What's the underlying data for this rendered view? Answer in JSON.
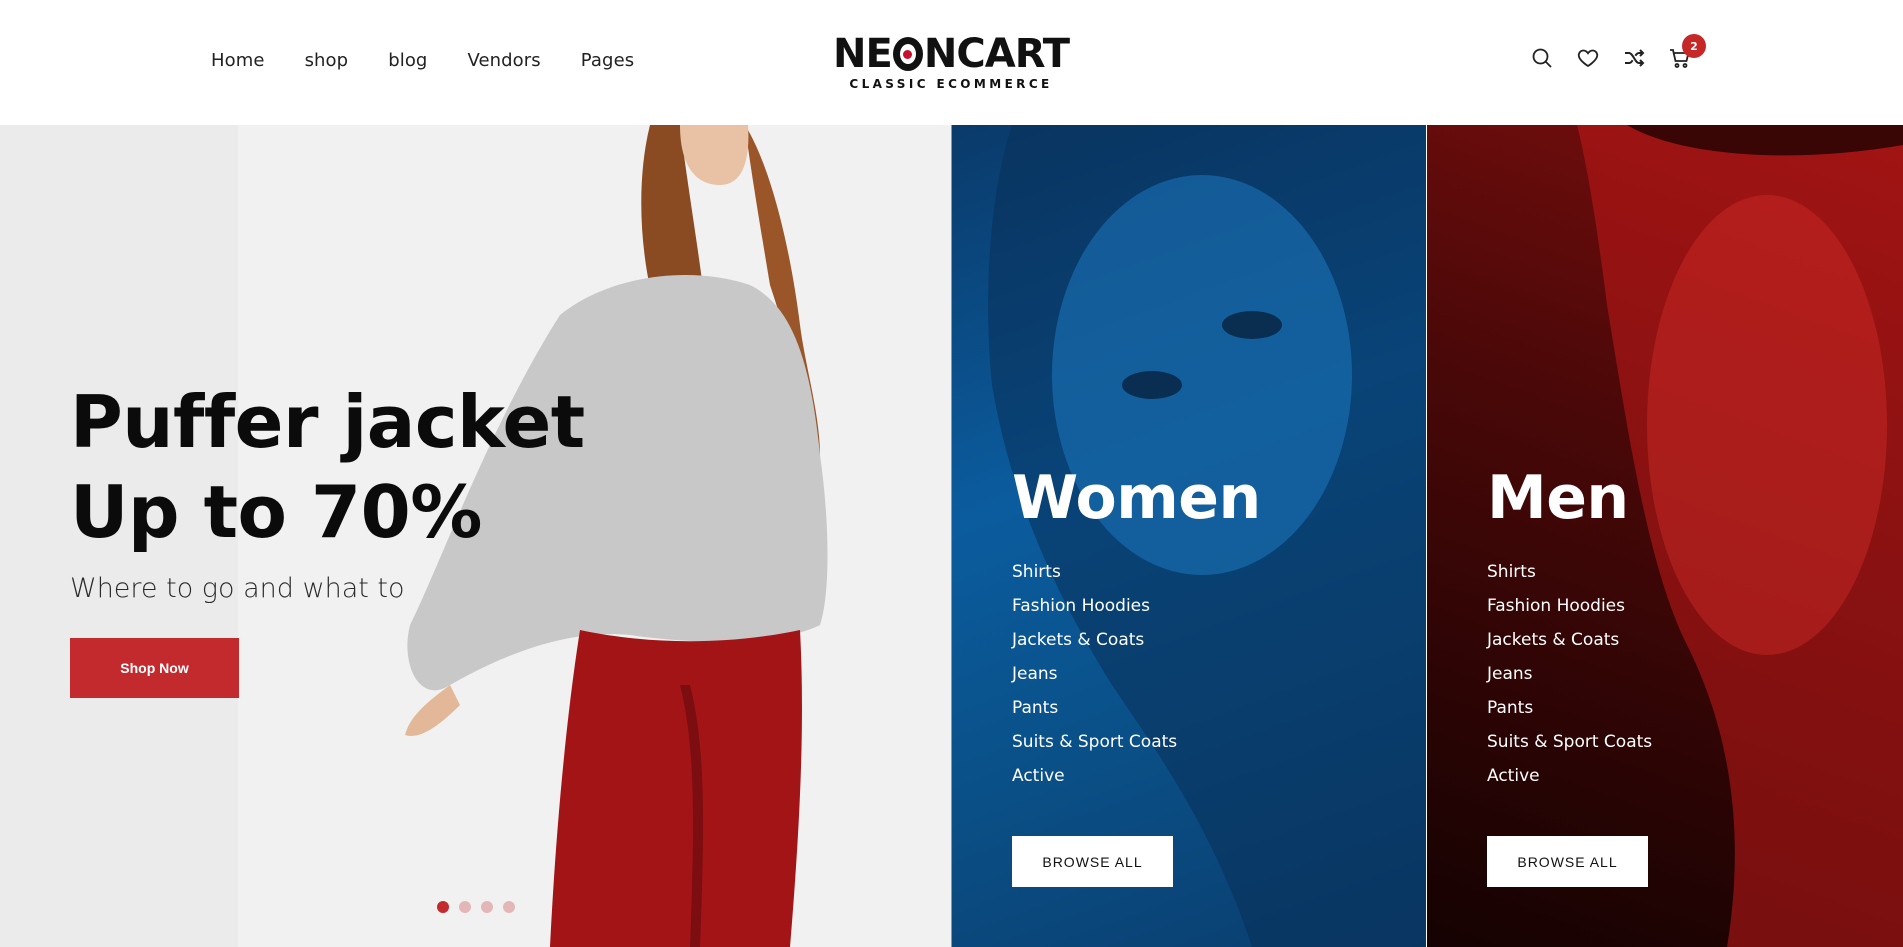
{
  "nav": {
    "items": [
      "Home",
      "shop",
      "blog",
      "Vendors",
      "Pages"
    ]
  },
  "logo": {
    "main_left": "NE",
    "main_right": "NCART",
    "subtitle": "CLASSIC ECOMMERCE"
  },
  "header_icons": {
    "search": "search-icon",
    "wishlist": "heart-icon",
    "compare": "shuffle-icon",
    "cart": "cart-icon",
    "cart_count": "2"
  },
  "hero": {
    "title_line1": "Puffer jacket",
    "title_line2": "Up to 70%",
    "subtitle": "Where to go and what to",
    "button_label": "Shop Now",
    "slides": 4,
    "active_slide": 1
  },
  "categories": [
    {
      "title": "Women",
      "items": [
        "Shirts",
        "Fashion Hoodies",
        "Jackets & Coats",
        "Jeans",
        "Pants",
        "Suits & Sport Coats",
        "Active"
      ],
      "button_label": "BROWSE ALL"
    },
    {
      "title": "Men",
      "items": [
        "Shirts",
        "Fashion Hoodies",
        "Jackets & Coats",
        "Jeans",
        "Pants",
        "Suits & Sport Coats",
        "Active"
      ],
      "button_label": "BROWSE ALL"
    }
  ],
  "colors": {
    "accent": "#c32a2e",
    "women_panel": "#0b5c9e",
    "men_panel": "#4a0808"
  }
}
